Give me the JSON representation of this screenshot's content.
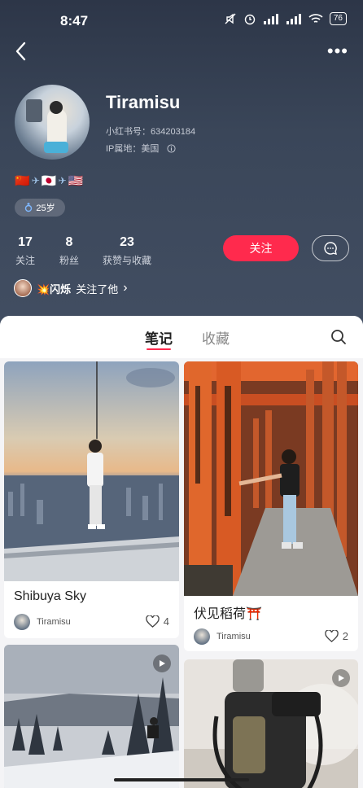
{
  "status_bar": {
    "time": "8:47",
    "battery": "76",
    "network": "HD"
  },
  "profile": {
    "username": "Tiramisu",
    "id_label": "小红书号：634203184",
    "ip_label": "IP属地：美国",
    "flags": [
      "🇨🇳",
      "✈",
      "🇯🇵",
      "✈",
      "🇺🇸"
    ],
    "age": "25岁",
    "stats": [
      {
        "value": "17",
        "label": "关注"
      },
      {
        "value": "8",
        "label": "粉丝"
      },
      {
        "value": "23",
        "label": "获赞与收藏"
      }
    ],
    "follow_button": "关注",
    "mutual": {
      "name": "💥闪烁",
      "text": "关注了他",
      "chevron": "›"
    }
  },
  "tabs": [
    {
      "label": "笔记",
      "active": true
    },
    {
      "label": "收藏",
      "active": false
    }
  ],
  "notes": [
    {
      "title": "Shibuya Sky",
      "author": "Tiramisu",
      "likes": "4",
      "video": false
    },
    {
      "title": "伏见稻荷⛩️",
      "author": "Tiramisu",
      "likes": "2",
      "video": false
    },
    {
      "title": "",
      "author": "",
      "likes": "",
      "video": true
    },
    {
      "title": "",
      "author": "",
      "likes": "",
      "video": true
    }
  ],
  "colors": {
    "accent": "#ff2a4d",
    "header_bg": "#36404f"
  },
  "icons": [
    "back-icon",
    "more-icon",
    "message-icon",
    "search-icon",
    "heart-icon",
    "play-icon",
    "info-icon",
    "male-icon"
  ]
}
